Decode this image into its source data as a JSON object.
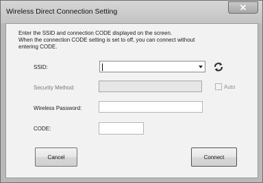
{
  "window": {
    "title": "Wireless Direct Connection Setting"
  },
  "intro": {
    "line1": "Enter the SSID and connection CODE displayed on the screen.",
    "line2": "When the connection CODE setting is set to off, you can connect without",
    "line3": "entering CODE."
  },
  "form": {
    "ssid_label": "SSID:",
    "ssid_value": "",
    "security_label": "Security Method:",
    "security_value": "",
    "auto_label": "Auto",
    "auto_checked": false,
    "password_label": "Wireless Password:",
    "password_value": "",
    "code_label": "CODE:",
    "code_value": ""
  },
  "buttons": {
    "cancel": "Cancel",
    "connect": "Connect"
  },
  "icons": {
    "close": "close-icon",
    "refresh": "refresh-icon",
    "dropdown": "chevron-down-icon"
  },
  "colors": {
    "title_bar": "#c9c9c9",
    "close_button": "#b4b4b4",
    "client_background": "#f2f2f2"
  }
}
